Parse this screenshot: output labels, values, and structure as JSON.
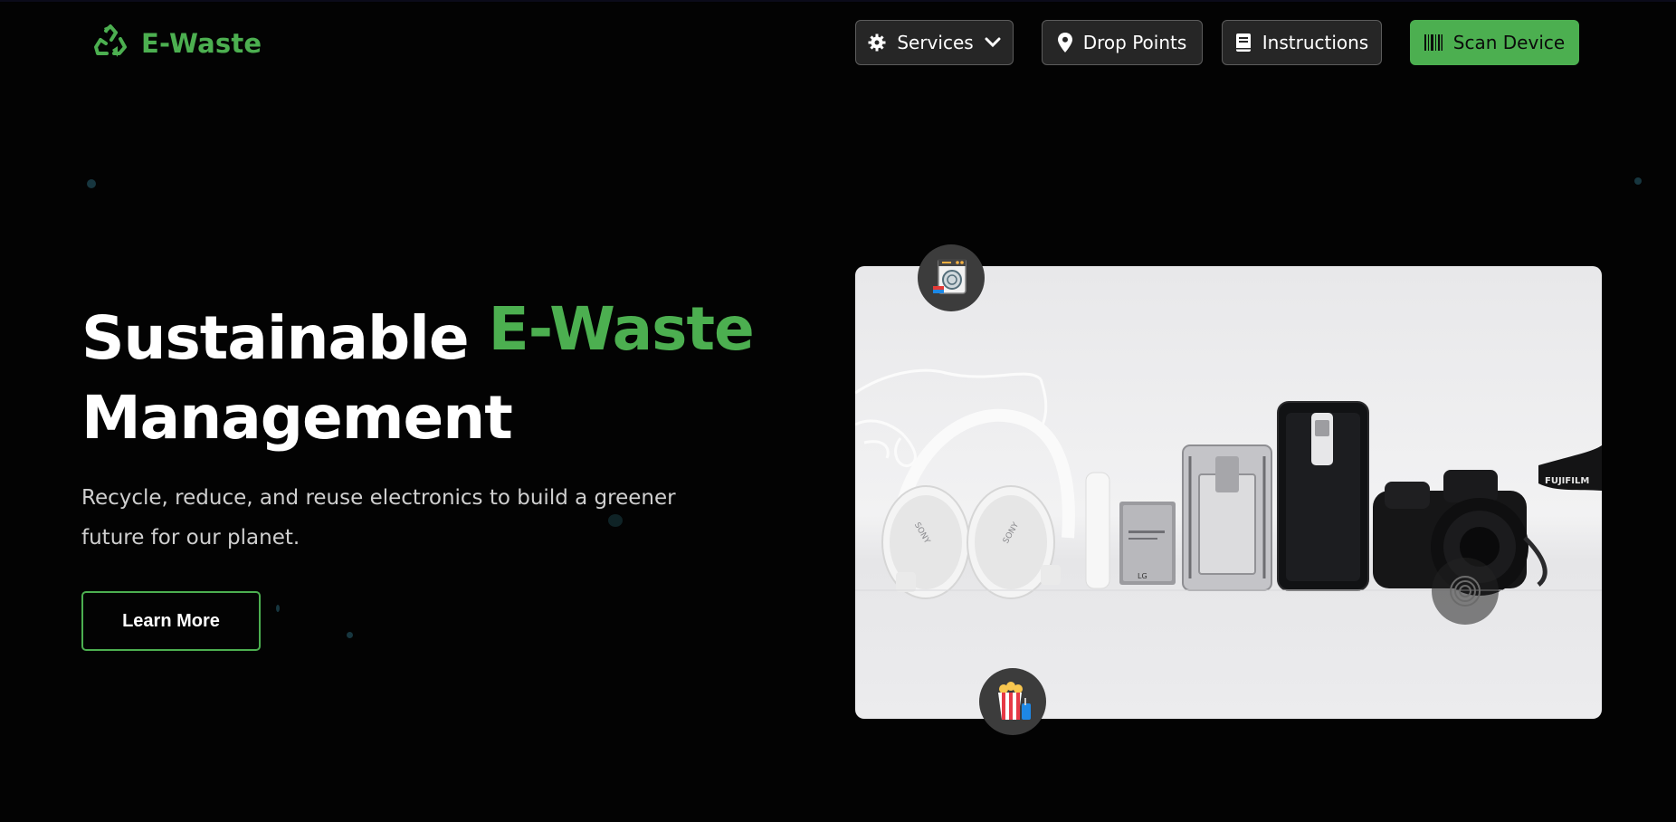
{
  "brand": {
    "name": "E-Waste",
    "icon": "recycle-icon",
    "color": "#4caf50"
  },
  "nav": {
    "services": {
      "label": "Services",
      "icon": "gear-icon",
      "dropdown_icon": "chevron-down-icon"
    },
    "drop_points": {
      "label": "Drop Points",
      "icon": "map-pin-icon"
    },
    "instructions": {
      "label": "Instructions",
      "icon": "book-icon"
    },
    "scan_device": {
      "label": "Scan Device",
      "icon": "barcode-icon"
    }
  },
  "hero": {
    "title_line1": "Sustainable",
    "title_accent": "E-Waste",
    "title_line2": "Management",
    "subtitle": "Recycle, reduce, and reuse electronics to build a greener future for our planet.",
    "cta_label": "Learn More"
  },
  "image": {
    "description_items": [
      "earphones",
      "headphones",
      "power-bank",
      "battery",
      "phone-case",
      "phone-case",
      "camera",
      "camera-strap"
    ],
    "headphone_brand": "SONY",
    "battery_brand": "LG",
    "camera_brand": "FUJIFILM"
  },
  "floating_icons": [
    "washing-machine-icon",
    "popcorn-icon",
    "spiral-icon"
  ],
  "colors": {
    "accent": "#4caf50",
    "background": "#030303",
    "button_dark": "#262626"
  }
}
